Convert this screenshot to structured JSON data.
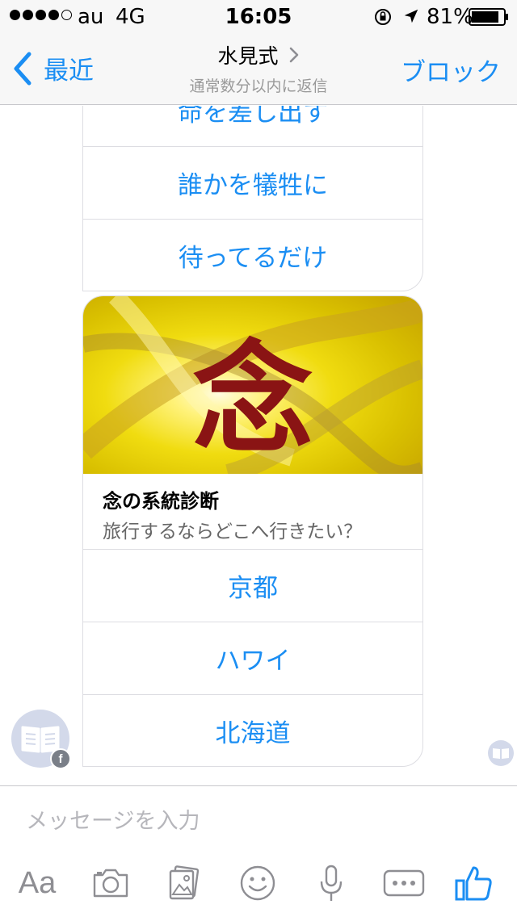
{
  "status_bar": {
    "carrier": "au",
    "network": "4G",
    "time": "16:05",
    "battery": "81%",
    "signal_bars": 4,
    "signal_total": 5
  },
  "nav": {
    "back_label": "最近",
    "title": "水見式",
    "subtitle": "通常数分以内に返信",
    "block_label": "ブロック"
  },
  "quick_replies_1": [
    {
      "label": "命を差し出す"
    },
    {
      "label": "誰かを犠牲に"
    },
    {
      "label": "待ってるだけ"
    }
  ],
  "card": {
    "image_text": "念",
    "title": "念の系統診断",
    "subtitle": "旅行するならどこへ行きたい？",
    "replies": [
      {
        "label": "京都"
      },
      {
        "label": "ハワイ"
      },
      {
        "label": "北海道"
      }
    ]
  },
  "composer": {
    "placeholder": "メッセージを入力",
    "aa_label": "Aa"
  },
  "colors": {
    "accent": "#1b8ef3",
    "icon_gray": "#8e8e93",
    "card_kanji": "#8a1414",
    "card_gold": "#e8d200"
  },
  "icons": {
    "back": "chevron-left-icon",
    "title_disclosure": "chevron-right-icon",
    "avatar": "book-icon",
    "avatar_badge": "facebook-icon",
    "read_receipt": "book-icon",
    "toolbar": [
      "text-format-icon",
      "camera-icon",
      "gallery-icon",
      "emoji-icon",
      "microphone-icon",
      "more-icon",
      "like-icon"
    ]
  }
}
